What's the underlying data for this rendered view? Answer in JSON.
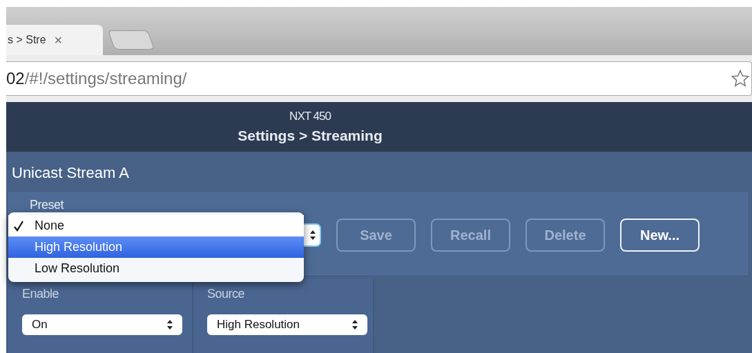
{
  "browser": {
    "tab": {
      "title": "s > Stre",
      "close": "×"
    },
    "address": {
      "host": "02",
      "path": "/#!/settings/streaming/"
    }
  },
  "header": {
    "device": "NXT 450",
    "title": "Settings > Streaming"
  },
  "section": {
    "title": "Unicast Stream A"
  },
  "preset": {
    "label": "Preset",
    "buttons": [
      {
        "label": "Save",
        "disabled": true
      },
      {
        "label": "Recall",
        "disabled": true
      },
      {
        "label": "Delete",
        "disabled": true
      },
      {
        "label": "New...",
        "disabled": false
      }
    ],
    "dropdown": {
      "options": [
        {
          "label": "None",
          "checked": true,
          "selected": false
        },
        {
          "label": "High Resolution",
          "checked": false,
          "selected": true
        },
        {
          "label": "Low Resolution",
          "checked": false,
          "selected": false
        }
      ]
    }
  },
  "fields": [
    {
      "label": "Enable",
      "value": "On"
    },
    {
      "label": "Source",
      "value": "High Resolution"
    }
  ]
}
